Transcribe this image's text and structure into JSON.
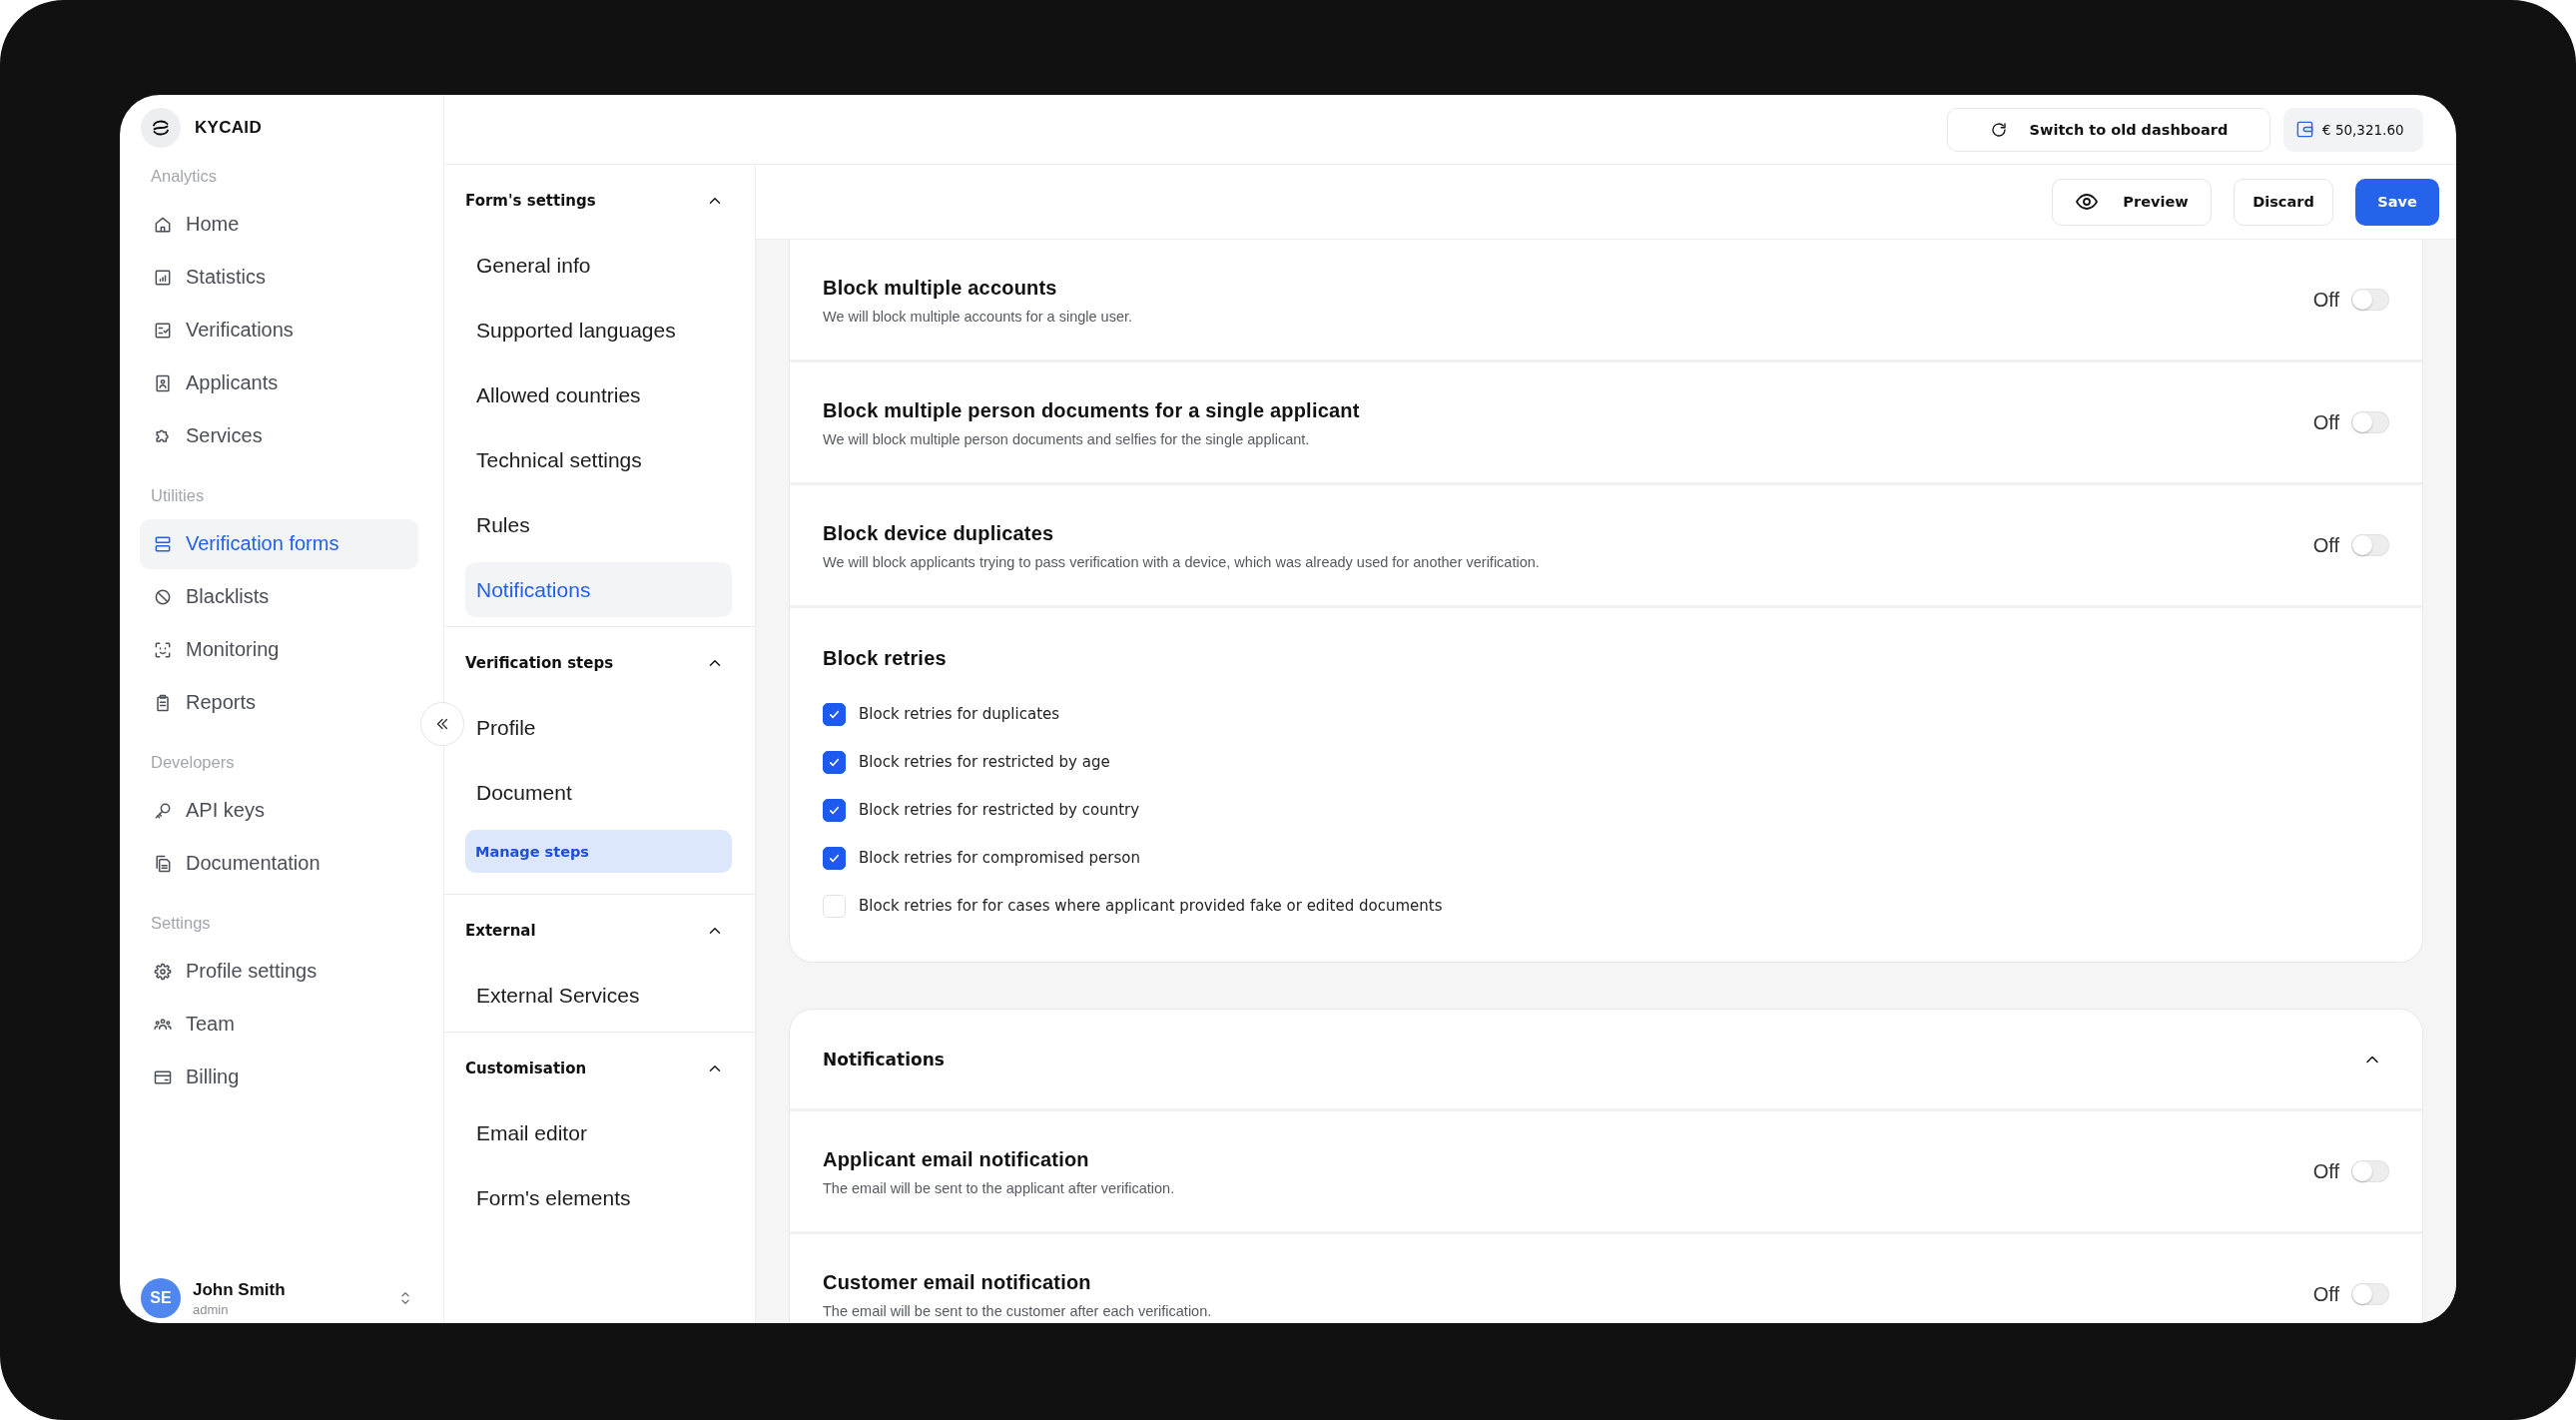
{
  "sidebar": {
    "brand": "KYCAID",
    "sections": [
      {
        "label": "Analytics",
        "items": [
          {
            "label": "Home",
            "selected": false
          },
          {
            "label": "Statistics",
            "selected": false
          },
          {
            "label": "Verifications",
            "selected": false
          },
          {
            "label": "Applicants",
            "selected": false
          },
          {
            "label": "Services",
            "selected": false
          }
        ]
      },
      {
        "label": "Utilities",
        "items": [
          {
            "label": "Verification forms",
            "selected": true
          },
          {
            "label": "Blacklists",
            "selected": false
          },
          {
            "label": "Monitoring",
            "selected": false
          },
          {
            "label": "Reports",
            "selected": false
          }
        ]
      },
      {
        "label": "Developers",
        "items": [
          {
            "label": "API keys",
            "selected": false
          },
          {
            "label": "Documentation",
            "selected": false
          }
        ]
      },
      {
        "label": "Settings",
        "items": [
          {
            "label": "Profile settings",
            "selected": false
          },
          {
            "label": "Team",
            "selected": false
          },
          {
            "label": "Billing",
            "selected": false
          }
        ]
      }
    ],
    "user": {
      "initials": "SE",
      "name": "John Smith",
      "role": "admin"
    }
  },
  "topbar": {
    "switch_button": "Switch to old dashboard",
    "balance": "€ 50,321.60"
  },
  "form_nav": [
    {
      "title": "Form's settings",
      "expanded": true,
      "items": [
        {
          "kind": "link",
          "label": "General info",
          "selected": false
        },
        {
          "kind": "link",
          "label": "Supported languages",
          "selected": false
        },
        {
          "kind": "link",
          "label": "Allowed countries",
          "selected": false
        },
        {
          "kind": "link",
          "label": "Technical settings",
          "selected": false
        },
        {
          "kind": "link",
          "label": "Rules",
          "selected": false
        },
        {
          "kind": "link",
          "label": "Notifications",
          "selected": true
        }
      ]
    },
    {
      "title": "Verification steps",
      "expanded": true,
      "items": [
        {
          "kind": "link",
          "label": "Profile",
          "selected": false
        },
        {
          "kind": "link",
          "label": "Document",
          "selected": false
        },
        {
          "kind": "action",
          "label": "Manage steps",
          "selected": false
        }
      ]
    },
    {
      "title": "External",
      "expanded": true,
      "items": [
        {
          "kind": "link",
          "label": "External Services",
          "selected": false
        }
      ]
    },
    {
      "title": "Customisation",
      "expanded": true,
      "items": [
        {
          "kind": "link",
          "label": "Email editor",
          "selected": false
        },
        {
          "kind": "link",
          "label": "Form's elements",
          "selected": false
        }
      ]
    }
  ],
  "actions": [
    {
      "kind": "preview",
      "label": "Preview"
    },
    {
      "kind": "discard",
      "label": "Discard"
    },
    {
      "kind": "save",
      "label": "Save"
    }
  ],
  "sections": [
    {
      "rows": [
        {
          "kind": "toggle",
          "title": "Block multiple accounts",
          "description": "We will block multiple accounts for a single user.",
          "state_label": "Off",
          "on": false
        },
        {
          "kind": "toggle",
          "title": "Block multiple person documents for a single applicant",
          "description": "We will block multiple person documents and selfies for the single applicant.",
          "state_label": "Off",
          "on": false
        },
        {
          "kind": "toggle",
          "title": "Block device duplicates",
          "description": "We will block applicants trying to pass verification with a device, which was already used for another verification.",
          "state_label": "Off",
          "on": false
        },
        {
          "kind": "checklist",
          "title": "Block retries",
          "options": [
            {
              "label": "Block retries for duplicates",
              "checked": true
            },
            {
              "label": "Block retries for restricted by age",
              "checked": true
            },
            {
              "label": "Block retries for restricted by country",
              "checked": true
            },
            {
              "label": "Block retries for compromised person",
              "checked": true
            },
            {
              "label": "Block retries for for cases where applicant provided fake or edited documents",
              "checked": false
            }
          ]
        }
      ]
    },
    {
      "title": "Notifications",
      "expanded": true,
      "rows": [
        {
          "kind": "toggle",
          "title": "Applicant email notification",
          "description": "The email will be sent to the applicant after verification.",
          "state_label": "Off",
          "on": false
        },
        {
          "kind": "toggle",
          "title": "Customer email notification",
          "description": "The email will be sent to the customer after each verification.",
          "state_label": "Off",
          "on": false
        }
      ]
    }
  ]
}
